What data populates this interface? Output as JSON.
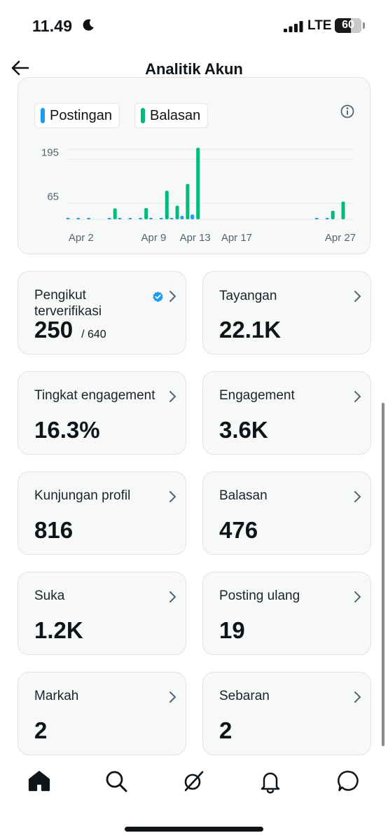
{
  "status_bar": {
    "time": "11.49",
    "network": "LTE",
    "battery_percent": 60,
    "battery_text": "60"
  },
  "header": {
    "title": "Analitik Akun"
  },
  "colors": {
    "posts": "#1d9bf0",
    "replies": "#00ba7c",
    "verified": "#1d9bf0"
  },
  "legend": {
    "posts": "Postingan",
    "replies": "Balasan"
  },
  "chart_data": {
    "type": "bar",
    "yticks": [
      195,
      65
    ],
    "ylim": [
      0,
      210
    ],
    "xlim": [
      1,
      27
    ],
    "xtick_labels": [
      {
        "x": 2,
        "label": "Apr 2"
      },
      {
        "x": 9,
        "label": "Apr 9"
      },
      {
        "x": 13,
        "label": "Apr 13"
      },
      {
        "x": 17,
        "label": "Apr 17"
      },
      {
        "x": 27,
        "label": "Apr 27"
      }
    ],
    "grid": true,
    "legend": "top-left",
    "series": [
      {
        "name": "Postingan",
        "color": "#1d9bf0",
        "points": [
          [
            1,
            4
          ],
          [
            2,
            3
          ],
          [
            3,
            3
          ],
          [
            5,
            3
          ],
          [
            6,
            3
          ],
          [
            7,
            3
          ],
          [
            8,
            3
          ],
          [
            9,
            3
          ],
          [
            10,
            3
          ],
          [
            11,
            4
          ],
          [
            12,
            10
          ],
          [
            13,
            14
          ],
          [
            25,
            4
          ],
          [
            26,
            3
          ]
        ]
      },
      {
        "name": "Balasan",
        "color": "#00ba7c",
        "points": [
          [
            5,
            32
          ],
          [
            8,
            33
          ],
          [
            10,
            84
          ],
          [
            11,
            40
          ],
          [
            12,
            104
          ],
          [
            13,
            275
          ],
          [
            26,
            25
          ],
          [
            27,
            52
          ]
        ]
      }
    ]
  },
  "stats": [
    {
      "label": "Pengikut terverifikasi",
      "value": "250",
      "sub": "/ 640",
      "verified": true
    },
    {
      "label": "Tayangan",
      "value": "22.1K"
    },
    {
      "label": "Tingkat engagement",
      "value": "16.3%"
    },
    {
      "label": "Engagement",
      "value": "3.6K"
    },
    {
      "label": "Kunjungan profil",
      "value": "816"
    },
    {
      "label": "Balasan",
      "value": "476"
    },
    {
      "label": "Suka",
      "value": "1.2K"
    },
    {
      "label": "Posting ulang",
      "value": "19"
    },
    {
      "label": "Markah",
      "value": "2"
    },
    {
      "label": "Sebaran",
      "value": "2"
    }
  ],
  "nav": [
    {
      "name": "home-icon",
      "active": true
    },
    {
      "name": "search-icon"
    },
    {
      "name": "grok-icon"
    },
    {
      "name": "bell-icon"
    },
    {
      "name": "messages-icon"
    }
  ]
}
